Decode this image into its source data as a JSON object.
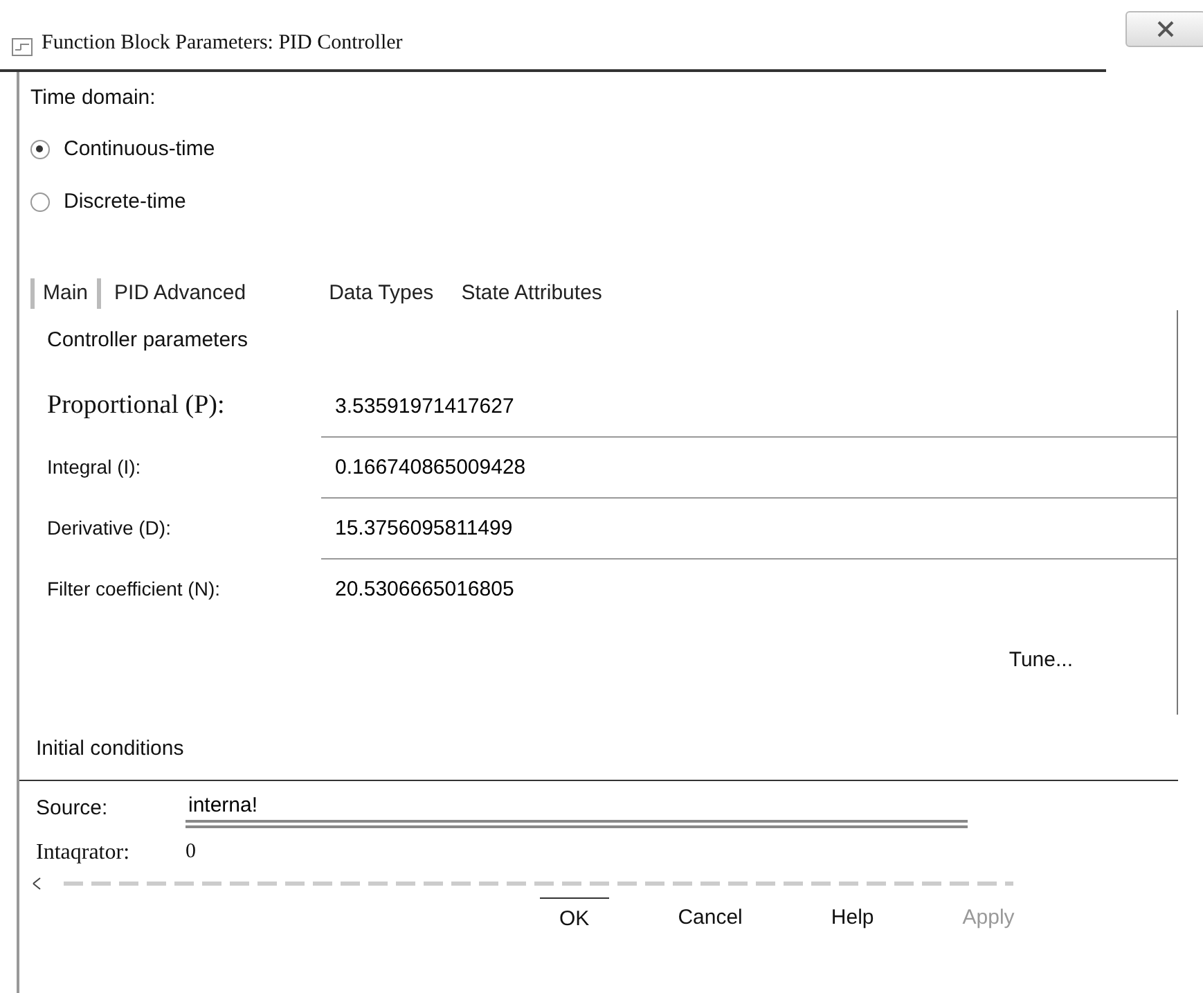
{
  "window": {
    "title": "Function Block Parameters: PID Controller"
  },
  "time_domain": {
    "label": "Time domain:",
    "options": [
      {
        "label": "Continuous-time",
        "selected": true
      },
      {
        "label": "Discrete-time",
        "selected": false
      }
    ]
  },
  "tabs": [
    {
      "label": "Main",
      "selected": true
    },
    {
      "label": "PID Advanced",
      "selected": false
    },
    {
      "label": "Data Types",
      "selected": false
    },
    {
      "label": "State Attributes",
      "selected": false
    }
  ],
  "controller_parameters": {
    "title": "Controller parameters",
    "fields": [
      {
        "label": "Proportional (P):",
        "value": "3.53591971417627"
      },
      {
        "label": "Integral (I):",
        "value": "0.166740865009428"
      },
      {
        "label": "Derivative (D):",
        "value": "15.3756095811499"
      },
      {
        "label": "Filter coefficient (N):",
        "value": "20.5306665016805"
      }
    ]
  },
  "tune_button": "Tune...",
  "initial_conditions": {
    "title": "Initial conditions",
    "source": {
      "label": "Source:",
      "value": "interna!"
    },
    "integrator": {
      "label": "Intaqrator:",
      "value": "0"
    }
  },
  "buttons": [
    {
      "label": "OK",
      "disabled": false
    },
    {
      "label": "Cancel",
      "disabled": false
    },
    {
      "label": "Help",
      "disabled": false
    },
    {
      "label": "Apply",
      "disabled": true
    }
  ]
}
